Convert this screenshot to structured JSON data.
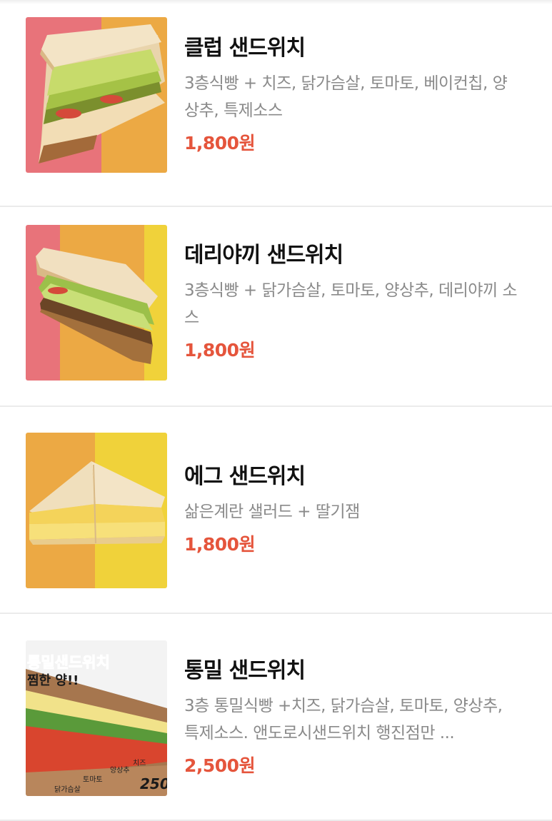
{
  "menu": {
    "items": [
      {
        "name": "클럽 샌드위치",
        "description": "3층식빵 + 치즈, 닭가슴살, 토마토, 베이컨칩, 양상추, 특제소스",
        "price": "1,800원",
        "image_icon": "club-sandwich-photo",
        "image_colors": [
          "#e8737a",
          "#eca944"
        ]
      },
      {
        "name": "데리야끼 샌드위치",
        "description": "3층식빵 + 닭가슴살, 토마토, 양상추, 데리야끼 소스",
        "price": "1,800원",
        "image_icon": "teriyaki-sandwich-photo",
        "image_colors": [
          "#e8737a",
          "#eca944",
          "#f0d23a"
        ]
      },
      {
        "name": "에그 샌드위치",
        "description": "삶은계란 샐러드 + 딸기잼",
        "price": "1,800원",
        "image_icon": "egg-sandwich-photo",
        "image_colors": [
          "#eca944",
          "#f0d23a"
        ]
      },
      {
        "name": "통밀 샌드위치",
        "description": "3층 통밀식빵 +치즈, 닭가슴살, 토마토, 양상추, 특제소스. 앤도로시샌드위치 행진점만 ...",
        "price": "2,500원",
        "image_icon": "wholewheat-sandwich-photo",
        "image_colors": [
          "#f3f3f3"
        ],
        "image_text": {
          "banner_line1": "통밀샌드위치",
          "banner_line2": "찜한 양!!",
          "label_chicken": "닭가슴살",
          "label_tomato": "토마토",
          "label_lettuce": "양상추",
          "label_cheese": "치즈",
          "price_fragment": "250"
        }
      }
    ]
  }
}
